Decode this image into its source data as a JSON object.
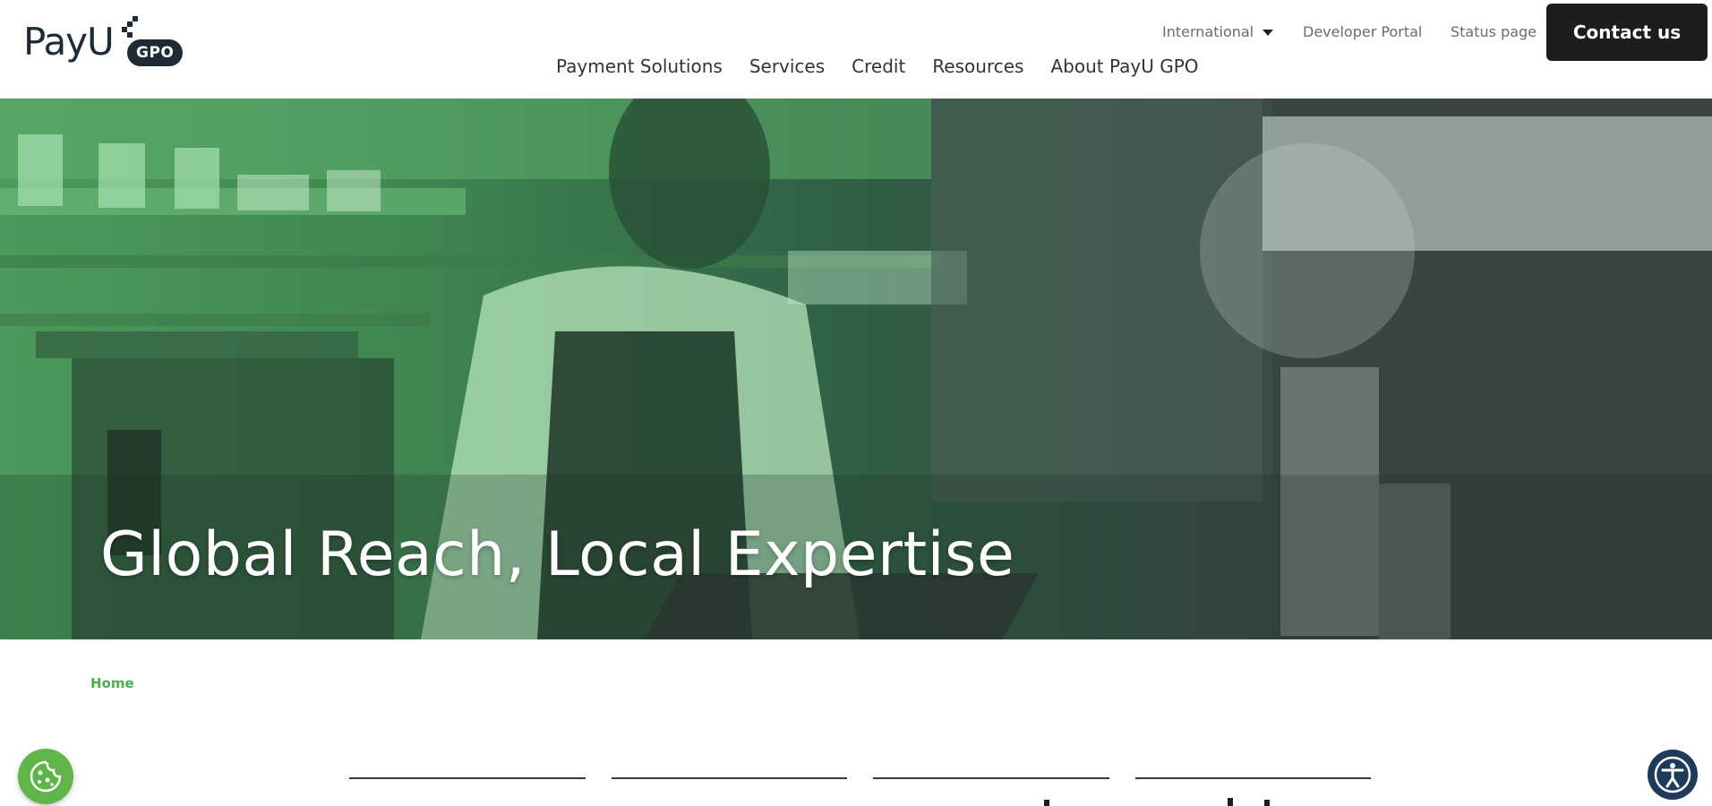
{
  "header": {
    "logo": {
      "text": "PayU",
      "badge": "GPO"
    },
    "top_links": {
      "international": "International",
      "developer_portal": "Developer Portal",
      "status_page": "Status page"
    },
    "contact_button": "Contact us",
    "nav": [
      {
        "label": "Payment Solutions"
      },
      {
        "label": "Services"
      },
      {
        "label": "Credit"
      },
      {
        "label": "Resources"
      },
      {
        "label": "About PayU GPO"
      }
    ]
  },
  "hero": {
    "title": "Global Reach, Local Expertise"
  },
  "breadcrumb": {
    "home": "Home"
  },
  "colors": {
    "brand_green": "#4caf50",
    "dark": "#1d1d1d",
    "hero_green": "#4d9a5c"
  },
  "icons": {
    "cookie": "cookie-icon",
    "accessibility": "accessibility-icon",
    "dropdown": "caret-down-icon"
  }
}
